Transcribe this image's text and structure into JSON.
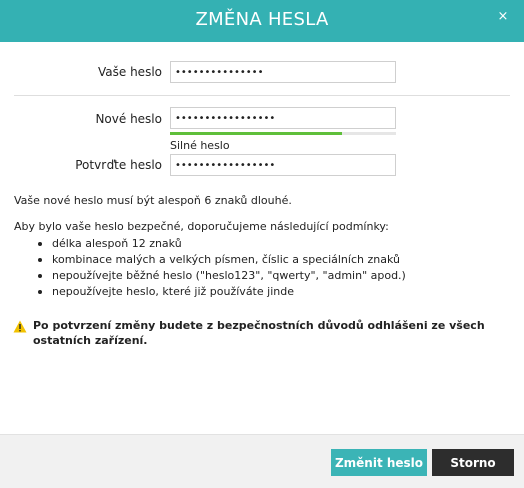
{
  "dialog": {
    "title": "ZMĚNA HESLA",
    "close_symbol": "×"
  },
  "form": {
    "current_password": {
      "label": "Vaše heslo",
      "value": "•••••••••••••••"
    },
    "new_password": {
      "label": "Nové heslo",
      "value": "•••••••••••••••••"
    },
    "confirm_password": {
      "label": "Potvrďte heslo",
      "value": "•••••••••••••••••"
    },
    "strength": {
      "label": "Silné heslo",
      "level": 0.76,
      "color": "#5fbf3a"
    }
  },
  "info": {
    "min_length": "Vaše nové heslo musí být alespoň 6 znaků dlouhé.",
    "recommend_intro": "Aby bylo vaše heslo bezpečné, doporučujeme následující podmínky:",
    "rules": [
      "délka alespoň 12 znaků",
      "kombinace malých a velkých písmen, číslic a speciálních znaků",
      "nepoužívejte běžné heslo (\"heslo123\", \"qwerty\", \"admin\" apod.)",
      "nepoužívejte heslo, které již používáte jinde"
    ],
    "warning": "Po potvrzení změny budete z bezpečnostních důvodů odhlášeni ze všech ostatních zařízení.",
    "warning_icon": "warning-triangle-icon"
  },
  "footer": {
    "submit_label": "Změnit heslo",
    "cancel_label": "Storno"
  },
  "colors": {
    "header": "#34b1b3",
    "primary_button": "#3bb4b6",
    "cancel_button": "#2d2d2d",
    "warning": "#f2c200"
  }
}
